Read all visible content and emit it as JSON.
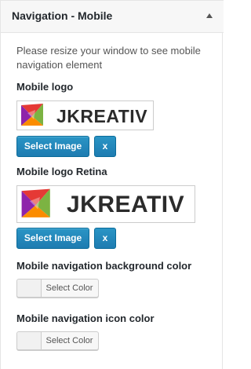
{
  "panel": {
    "title": "Navigation - Mobile"
  },
  "description": "Please resize your window to see mobile navigation element",
  "mobile_logo": {
    "label": "Mobile logo",
    "logo_text": "JKREATIV",
    "select_button": "Select Image",
    "remove_button": "x"
  },
  "mobile_logo_retina": {
    "label": "Mobile logo Retina",
    "logo_text": "JKREATIV",
    "select_button": "Select Image",
    "remove_button": "x"
  },
  "nav_bg_color": {
    "label": "Mobile navigation background color",
    "button": "Select Color"
  },
  "nav_icon_color": {
    "label": "Mobile navigation icon color",
    "button": "Select Color"
  },
  "colors": {
    "primary_button": "#1e7cb1",
    "logo_red": "#e53935",
    "logo_green": "#7cb342",
    "logo_purple": "#8e24aa",
    "logo_orange": "#fb8c00"
  }
}
